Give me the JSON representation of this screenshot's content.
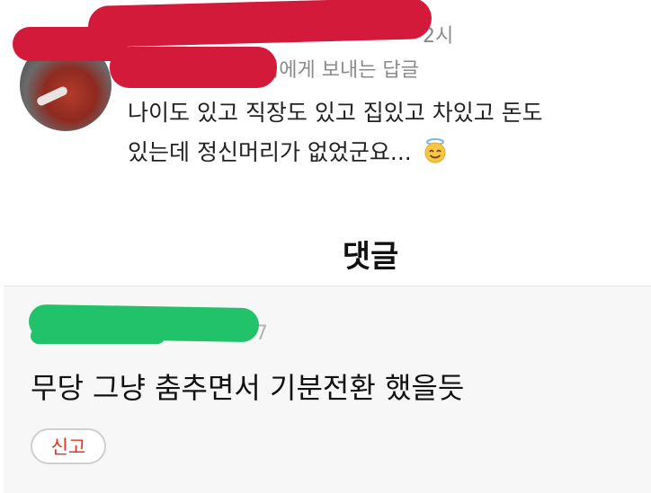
{
  "reply": {
    "time_text": "2시",
    "reply_to_text": "님에게 보내는 답글",
    "body_line1": "나이도 있고 직장도 있고 집있고 차있고 돈도",
    "body_line2": "있는데 정신머리가 없었군요...",
    "emoji_icon": "smiling-face-with-halo",
    "redact_color": "#d31a3b"
  },
  "section": {
    "title": "댓글"
  },
  "comment": {
    "meta_text": "7",
    "redact_color": "#22c26a",
    "body": "무당 그냥 춤추면서 기분전환 했을듯",
    "report_label": "신고",
    "report_color": "#e0332c"
  }
}
